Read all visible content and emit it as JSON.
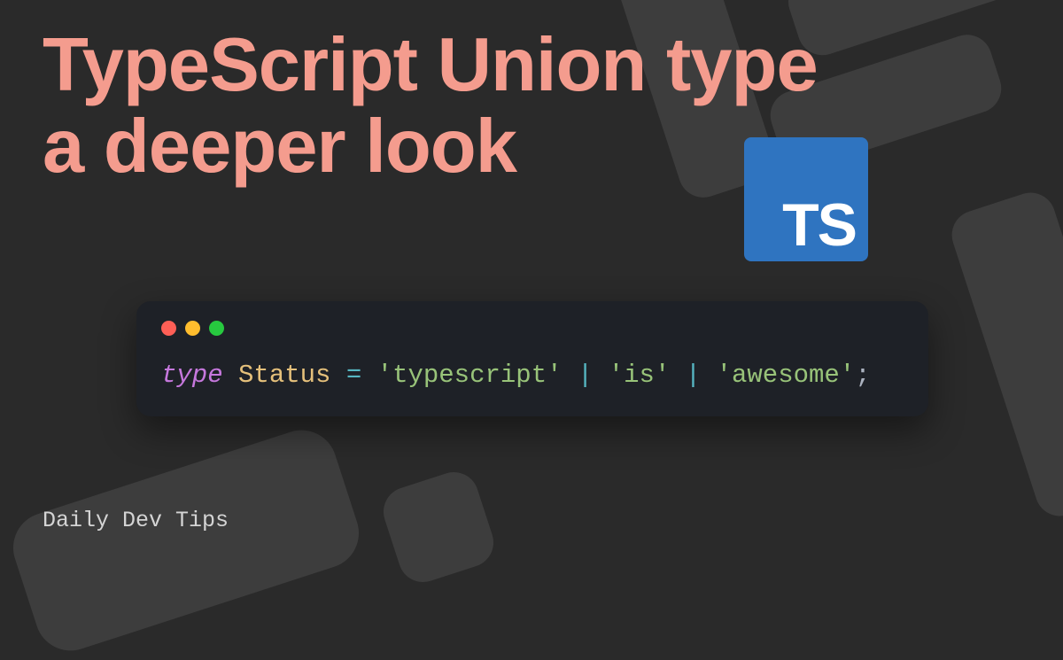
{
  "title_line1": "TypeScript Union type",
  "title_line2": "a deeper look",
  "logo_text": "TS",
  "code": {
    "keyword": "type",
    "type_name": "Status",
    "equals": "=",
    "pipe": "|",
    "string1": "'typescript'",
    "string2": "'is'",
    "string3": "'awesome'",
    "semicolon": ";"
  },
  "footer": "Daily Dev Tips",
  "colors": {
    "background": "#2a2a2a",
    "shape": "#3d3d3d",
    "title": "#f49c8e",
    "logo_bg": "#2f74c0",
    "code_bg": "#1e2127",
    "keyword": "#c678dd",
    "type": "#e5c07b",
    "op": "#56b6c2",
    "string": "#98c379",
    "punct": "#abb2bf"
  }
}
